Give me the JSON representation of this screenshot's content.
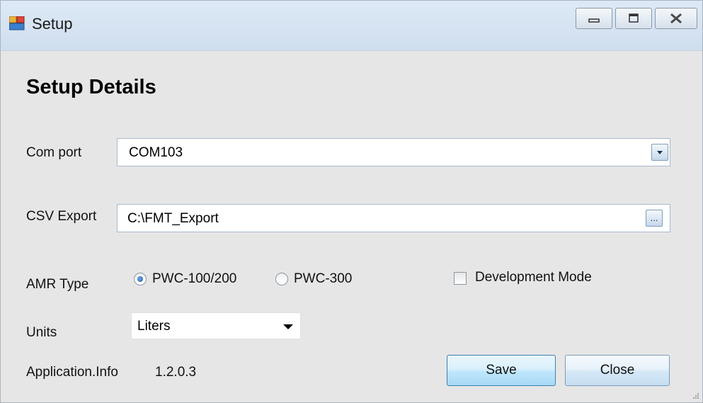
{
  "window": {
    "title": "Setup"
  },
  "heading": "Setup Details",
  "com_port": {
    "label": "Com port",
    "value": "COM103"
  },
  "csv_export": {
    "label": "CSV Export",
    "value": "C:\\FMT_Export",
    "browse_label": "..."
  },
  "amr_type": {
    "label": "AMR Type",
    "options": [
      {
        "label": "PWC-100/200",
        "selected": true
      },
      {
        "label": "PWC-300",
        "selected": false
      }
    ]
  },
  "development_mode": {
    "label": "Development Mode",
    "checked": false
  },
  "units": {
    "label": "Units",
    "value": "Liters"
  },
  "app_info": {
    "label": "Application.Info",
    "version": "1.2.0.3"
  },
  "buttons": {
    "save": "Save",
    "close": "Close"
  },
  "icons": {
    "app": "setup-app-icon",
    "minimize": "minimize-icon",
    "maximize": "maximize-icon",
    "close": "close-icon",
    "dropdown": "chevron-down-icon"
  }
}
